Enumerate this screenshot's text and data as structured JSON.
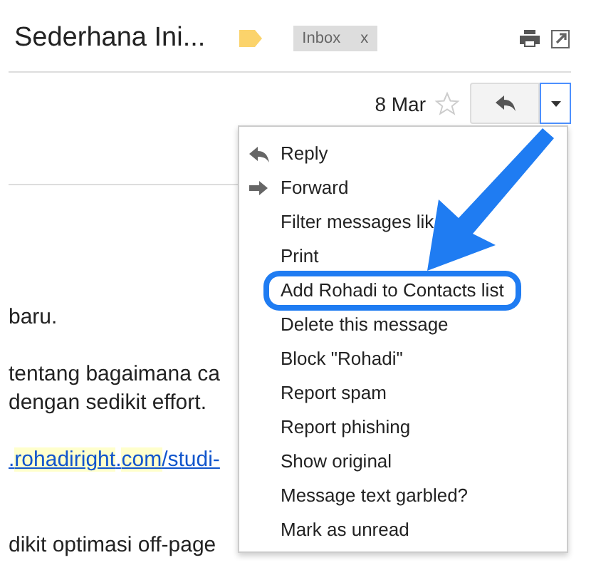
{
  "subject": "Sederhana Ini...",
  "chip": {
    "label": "Inbox",
    "close": "x"
  },
  "date": "8 Mar",
  "starred": false,
  "menu": {
    "open": true,
    "items": [
      {
        "label": "Reply",
        "highlighted": false
      },
      {
        "label": "Forward",
        "highlighted": false
      },
      {
        "label": "Filter messages lik",
        "highlighted": false
      },
      {
        "label": "Print",
        "highlighted": false
      },
      {
        "label": "Add Rohadi to Contacts list",
        "highlighted": true
      },
      {
        "label": "Delete this message",
        "highlighted": false
      },
      {
        "label": "Block \"Rohadi\"",
        "highlighted": false
      },
      {
        "label": "Report spam",
        "highlighted": false
      },
      {
        "label": "Report phishing",
        "highlighted": false
      },
      {
        "label": "Show original",
        "highlighted": false
      },
      {
        "label": "Message text garbled?",
        "highlighted": false
      },
      {
        "label": "Mark as unread",
        "highlighted": false
      }
    ]
  },
  "body": [
    {
      "kind": "text",
      "text": "baru."
    },
    {
      "kind": "gap"
    },
    {
      "kind": "text",
      "text": "tentang bagaimana ca"
    },
    {
      "kind": "text",
      "text": "dengan sedikit effort."
    },
    {
      "kind": "gap"
    },
    {
      "kind": "link",
      "parts": [
        {
          "text": ".",
          "highlighted": false
        },
        {
          "text": "rohadiright",
          "highlighted": true
        },
        {
          "text": ".",
          "highlighted": false
        },
        {
          "text": "com",
          "highlighted": true
        },
        {
          "text": "/studi-",
          "highlighted": false
        }
      ]
    },
    {
      "kind": "gap"
    },
    {
      "kind": "gap"
    },
    {
      "kind": "text",
      "text": "dikit optimasi off-page"
    }
  ]
}
